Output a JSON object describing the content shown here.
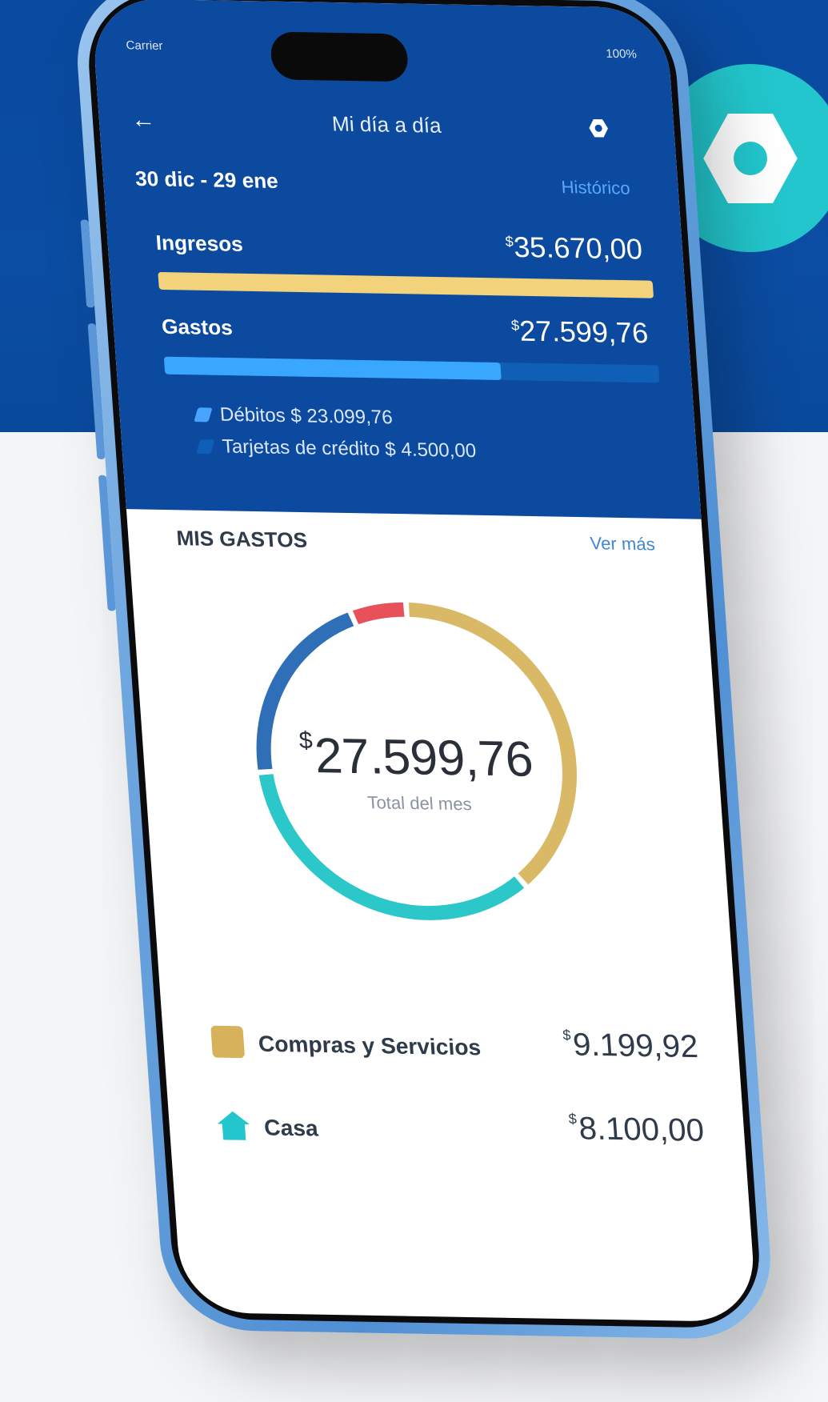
{
  "status_bar": {
    "carrier": "Carrier",
    "battery": "100%"
  },
  "header": {
    "title": "Mi día a día"
  },
  "range": {
    "label": "30 dic - 29 ene",
    "link": "Histórico"
  },
  "income": {
    "label": "Ingresos",
    "currency": "$",
    "amount": "35.670,00"
  },
  "expenses": {
    "label": "Gastos",
    "currency": "$",
    "amount": "27.599,76",
    "fill_fraction": 0.68
  },
  "legend": [
    {
      "label": "Débitos $ 23.099,76",
      "color": "#49a3ff"
    },
    {
      "label": "Tarjetas de crédito $ 4.500,00",
      "color": "#0f5fb7"
    }
  ],
  "section": {
    "title": "MIS GASTOS",
    "link": "Ver más"
  },
  "donut": {
    "currency": "$",
    "amount": "27.599,76",
    "subtitle": "Total del mes",
    "segments": [
      {
        "name": "Compras y Servicios",
        "fraction": 0.34,
        "color": "#d9b866"
      },
      {
        "name": "Casa",
        "fraction": 0.3,
        "color": "#2bc7c9"
      },
      {
        "name": "other-blue",
        "fraction": 0.18,
        "color": "#2f6fb8"
      },
      {
        "name": "other-red",
        "fraction": 0.05,
        "color": "#e8505a"
      }
    ]
  },
  "categories": [
    {
      "label": "Compras y Servicios",
      "currency": "$",
      "amount": "9.199,92"
    },
    {
      "label": "Casa",
      "currency": "$",
      "amount": "8.100,00"
    }
  ],
  "colors": {
    "accent": "#22c6cc",
    "brand_blue": "#0b4a9e",
    "income_bar": "#f2d27a"
  }
}
